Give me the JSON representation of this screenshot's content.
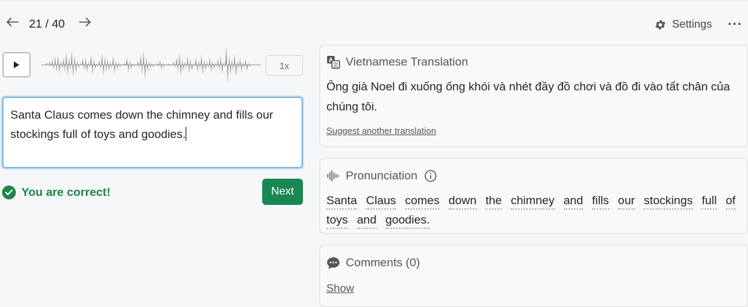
{
  "nav": {
    "prev_icon": "arrow-left-icon",
    "next_icon": "arrow-right-icon",
    "counter": "21 / 40",
    "settings_label": "Settings",
    "more_label": "···"
  },
  "audio": {
    "play_icon": "play-icon",
    "speed_label": "1x"
  },
  "answer": {
    "value": "Santa Claus comes down the chimney and fills our stockings full of toys and goodies."
  },
  "feedback": {
    "correct_text": "You are correct!",
    "next_label": "Next",
    "status_color": "#1e8449",
    "button_color": "#198754"
  },
  "translation": {
    "title": "Vietnamese Translation",
    "text": "Ông già Noel đi xuống ống khói và nhét đầy đồ chơi và đồ đi vào tất chân của chúng tôi.",
    "suggest_label": "Suggest another translation"
  },
  "pronunciation": {
    "title": "Pronunciation",
    "info_icon": "info-icon",
    "words": [
      "Santa",
      "Claus",
      "comes",
      "down",
      "the",
      "chimney",
      "and",
      "fills",
      "our",
      "stockings",
      "full",
      "of",
      "toys",
      "and",
      "goodies."
    ]
  },
  "comments": {
    "title": "Comments (0)",
    "show_label": "Show"
  }
}
